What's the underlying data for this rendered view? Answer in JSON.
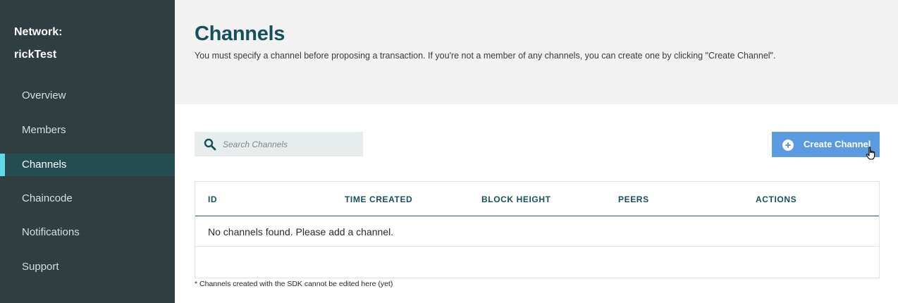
{
  "sidebar": {
    "network_label": "Network:",
    "network_name": "rickTest",
    "items": [
      {
        "label": "Overview",
        "active": false
      },
      {
        "label": "Members",
        "active": false
      },
      {
        "label": "Channels",
        "active": true
      },
      {
        "label": "Chaincode",
        "active": false
      },
      {
        "label": "Notifications",
        "active": false
      },
      {
        "label": "Support",
        "active": false
      }
    ]
  },
  "header": {
    "title": "Channels",
    "description": "You must specify a channel before proposing a transaction. If you're not a member of any channels, you can create one by clicking \"Create Channel\"."
  },
  "search": {
    "placeholder": "Search Channels",
    "value": "",
    "icon": "search-icon"
  },
  "create_button": {
    "label": "Create Channel",
    "icon": "plus-circle-icon"
  },
  "table": {
    "columns": [
      "ID",
      "TIME CREATED",
      "BLOCK HEIGHT",
      "PEERS",
      "ACTIONS"
    ],
    "empty_message": "No channels found. Please add a channel."
  },
  "footnote": "* Channels created with the SDK cannot be edited here (yet)",
  "colors": {
    "sidebar_bg": "#2f3e40",
    "active_item_bg": "#254d51",
    "active_indicator": "#5fd9e6",
    "title": "#17505a",
    "button_bg": "#5a9ae0",
    "header_bg": "#f2f2f2"
  }
}
